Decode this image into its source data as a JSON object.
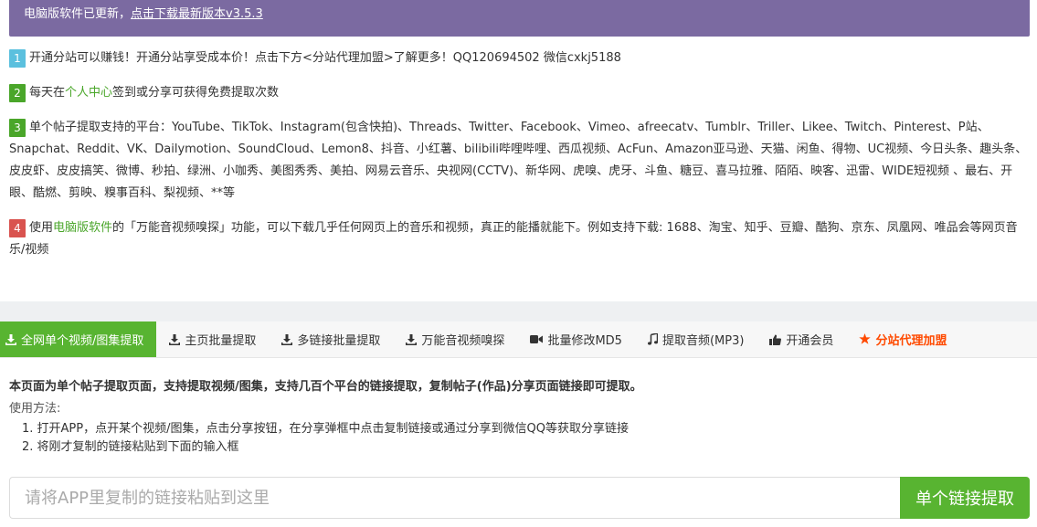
{
  "banner": {
    "text": "电脑版软件已更新，",
    "link": "点击下载最新版本v3.5.3"
  },
  "notices": [
    {
      "num": "1",
      "color": "#5bc0de",
      "text": "开通分站可以赚钱！开通分站享受成本价！点击下方<分站代理加盟>了解更多！QQ120694502 微信cxkj5188"
    },
    {
      "num": "2",
      "color": "#4aa62a",
      "before": "每天在",
      "link": "个人中心",
      "after": "签到或分享可获得免费提取次数"
    },
    {
      "num": "3",
      "color": "#4aa62a",
      "text": "单个帖子提取支持的平台：YouTube、TikTok、Instagram(包含快拍)、Threads、Twitter、Facebook、Vimeo、afreecatv、Tumblr、Triller、Likee、Twitch、Pinterest、P站、Snapchat、Reddit、VK、Dailymotion、SoundCloud、Lemon8、抖音、小红薯、bilibili哔哩哔哩、西瓜视频、AcFun、Amazon亚马逊、天猫、闲鱼、得物、UC视频、今日头条、趣头条、皮皮虾、皮皮搞笑、微博、秒拍、绿洲、小咖秀、美图秀秀、美拍、网易云音乐、央视网(CCTV)、新华网、虎嗅、虎牙、斗鱼、糖豆、喜马拉雅、陌陌、映客、迅雷、WIDE短视频 、最右、开眼、酷燃、剪映、糗事百科、梨视频、**等"
    },
    {
      "num": "4",
      "color": "#d9534f",
      "before": "使用",
      "link": "电脑版软件",
      "after": "的「万能音视频嗅探」功能，可以下载几乎任何网页上的音乐和视频，真正的能播就能下。例如支持下载: 1688、淘宝、知乎、豆瓣、酷狗、京东、凤凰网、唯品会等网页音乐/视频"
    }
  ],
  "tabs": [
    {
      "label": "全网单个视频/图集提取",
      "icon": "download-icon",
      "active": true
    },
    {
      "label": "主页批量提取",
      "icon": "download-icon"
    },
    {
      "label": "多链接批量提取",
      "icon": "download-icon"
    },
    {
      "label": "万能音视频嗅探",
      "icon": "download-icon"
    },
    {
      "label": "批量修改MD5",
      "icon": "video-camera-icon"
    },
    {
      "label": "提取音频(MP3)",
      "icon": "music-note-icon"
    },
    {
      "label": "开通会员",
      "icon": "thumbs-up-icon"
    },
    {
      "label": "分站代理加盟",
      "icon": "star-icon",
      "accent": "#ff4a00"
    }
  ],
  "description": {
    "headline": "本页面为单个帖子提取页面，支持提取视频/图集，支持几百个平台的链接提取，复制帖子(作品)分享页面链接即可提取。",
    "usage_label": "使用方法:",
    "steps": [
      "1. 打开APP，点开某个视频/图集，点击分享按钮，在分享弹框中点击复制链接或通过分享到微信QQ等获取分享链接",
      "2. 将刚才复制的链接粘贴到下面的输入框"
    ]
  },
  "search": {
    "placeholder": "请将APP里复制的链接粘贴到这里",
    "button_label": "单个链接提取"
  },
  "colors": {
    "banner_bg": "#7b6aa1",
    "accent_green": "#58b431",
    "partner_red": "#ff4a00"
  }
}
